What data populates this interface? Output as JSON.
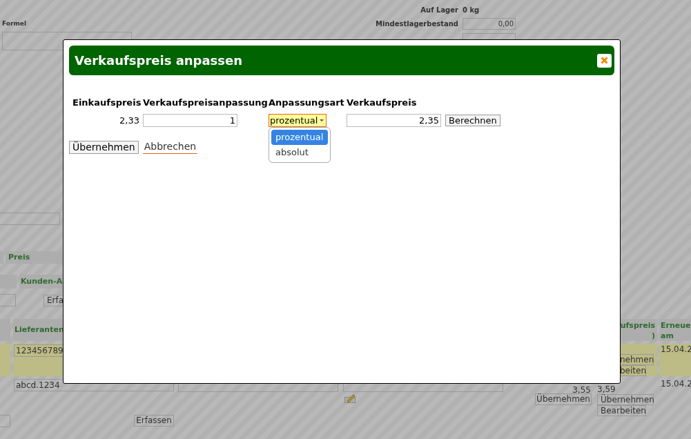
{
  "background": {
    "stock_info": {
      "auf_lager_label": "Auf Lager",
      "auf_lager_value": "0 kg",
      "mindestlager_label": "Mindestlagerbestand",
      "mindestlager_value": "0,00"
    },
    "formel_label": "Formel",
    "price_header": "Preis",
    "customer_header": "Kunden-A",
    "customer_add_button": "Erfa",
    "table": {
      "columns": [
        {
          "lines": [
            "Lieferanten"
          ]
        },
        {
          "lines": [
            "ufspreis",
            ")"
          ]
        },
        {
          "lines": [
            "Erneue",
            "am"
          ]
        }
      ],
      "rows": [
        {
          "highlighted": true,
          "supplier_number": "123456789",
          "buttons": [
            "nehmen",
            "beiten"
          ],
          "date": "15.04.2"
        },
        {
          "highlighted": false,
          "supplier_number": "abcd.1234",
          "price": "3,55",
          "price_button": "Übernehmen",
          "sale_price": "3,59",
          "buttons": [
            "Übernehmen",
            "Bearbeiten"
          ],
          "date": "15.04.2"
        }
      ]
    },
    "add_button": "Erfassen"
  },
  "dialog": {
    "title": "Verkaufspreis anpassen",
    "columns": [
      "Einkaufspreis",
      "Verkaufspreisanpassung",
      "Anpassungsart",
      "Verkaufspreis"
    ],
    "purchase_price": "2,33",
    "adjustment": "1",
    "adjustment_type": "prozentual",
    "dropdown": {
      "expanded": true,
      "options": [
        {
          "label": "prozentual",
          "selected": true
        },
        {
          "label": "absolut",
          "selected": false
        }
      ]
    },
    "sale_price": "2,35",
    "calculate_button": "Berechnen",
    "buttons": [
      {
        "label": "Übernehmen",
        "kind": "button"
      },
      {
        "label": "Abbrechen",
        "kind": "link"
      }
    ]
  }
}
